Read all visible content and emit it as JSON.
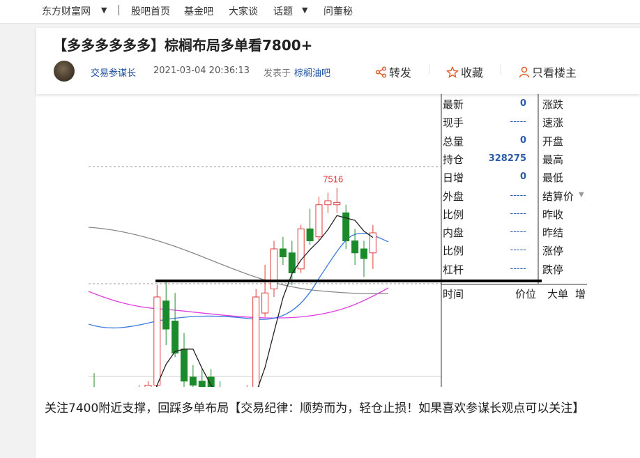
{
  "nav": {
    "site": "东方财富网",
    "items": [
      "股吧首页",
      "基金吧",
      "大家谈",
      "话题",
      "问董秘"
    ]
  },
  "post": {
    "title": "【多多多多多多】棕榈布局多单看7800+",
    "author": "交易参谋长",
    "datetime": "2021-03-04 20:36:13",
    "posted_in": "发表于",
    "bar_name": "棕榈油吧",
    "content": "关注7400附近支撑，回踩多单布局【交易纪律：顺势而为，轻仓止损！如果喜欢参谋长观点可以关注】"
  },
  "actions": {
    "share": "转发",
    "favorite": "收藏",
    "author_only": "只看楼主"
  },
  "colors": {
    "up": "#e03a3a",
    "down": "#1a8a2a",
    "link": "#1a4e9c",
    "value": "#2a5aa8"
  },
  "chart_data": {
    "type": "candlestick",
    "peak_label": "7516",
    "candles": [
      {
        "o": 7260,
        "h": 7285,
        "l": 7205,
        "c": 7215
      },
      {
        "o": 7235,
        "h": 7255,
        "l": 7215,
        "c": 7220
      },
      {
        "o": 7225,
        "h": 7240,
        "l": 7195,
        "c": 7215
      },
      {
        "o": 7220,
        "h": 7245,
        "l": 7200,
        "c": 7210
      },
      {
        "o": 7205,
        "h": 7235,
        "l": 7170,
        "c": 7230
      },
      {
        "o": 7235,
        "h": 7270,
        "l": 7225,
        "c": 7260
      },
      {
        "o": 7250,
        "h": 7275,
        "l": 7240,
        "c": 7270
      },
      {
        "o": 7270,
        "h": 7395,
        "l": 7260,
        "c": 7380
      },
      {
        "o": 7375,
        "h": 7400,
        "l": 7320,
        "c": 7340
      },
      {
        "o": 7350,
        "h": 7385,
        "l": 7305,
        "c": 7310
      },
      {
        "o": 7315,
        "h": 7335,
        "l": 7265,
        "c": 7275
      },
      {
        "o": 7280,
        "h": 7295,
        "l": 7255,
        "c": 7270
      },
      {
        "o": 7275,
        "h": 7290,
        "l": 7255,
        "c": 7260
      },
      {
        "o": 7280,
        "h": 7290,
        "l": 7225,
        "c": 7235
      },
      {
        "o": 7240,
        "h": 7275,
        "l": 7220,
        "c": 7225
      },
      {
        "o": 7255,
        "h": 7265,
        "l": 7205,
        "c": 7220
      },
      {
        "o": 7230,
        "h": 7245,
        "l": 7210,
        "c": 7215
      },
      {
        "o": 7250,
        "h": 7270,
        "l": 7240,
        "c": 7260
      },
      {
        "o": 7255,
        "h": 7390,
        "l": 7250,
        "c": 7380
      },
      {
        "o": 7360,
        "h": 7420,
        "l": 7355,
        "c": 7385
      },
      {
        "o": 7390,
        "h": 7450,
        "l": 7380,
        "c": 7440
      },
      {
        "o": 7440,
        "h": 7455,
        "l": 7420,
        "c": 7430
      },
      {
        "o": 7435,
        "h": 7450,
        "l": 7395,
        "c": 7410
      },
      {
        "o": 7415,
        "h": 7470,
        "l": 7410,
        "c": 7465
      },
      {
        "o": 7465,
        "h": 7490,
        "l": 7445,
        "c": 7450
      },
      {
        "o": 7455,
        "h": 7505,
        "l": 7450,
        "c": 7495
      },
      {
        "o": 7495,
        "h": 7510,
        "l": 7485,
        "c": 7500
      },
      {
        "o": 7495,
        "h": 7516,
        "l": 7485,
        "c": 7498
      },
      {
        "o": 7485,
        "h": 7495,
        "l": 7440,
        "c": 7450
      },
      {
        "o": 7450,
        "h": 7465,
        "l": 7420,
        "c": 7435
      },
      {
        "o": 7440,
        "h": 7450,
        "l": 7405,
        "c": 7428
      },
      {
        "o": 7435,
        "h": 7470,
        "l": 7415,
        "c": 7460
      }
    ],
    "support_level": 7400
  },
  "quote_panel": {
    "rows": [
      {
        "label": "最新",
        "value": "0",
        "label2": "涨跌"
      },
      {
        "label": "现手",
        "value": "-----",
        "label2": "速涨"
      },
      {
        "label": "总量",
        "value": "0",
        "label2": "开盘"
      },
      {
        "label": "持仓",
        "value": "328275",
        "label2": "最高"
      },
      {
        "label": "日增",
        "value": "0",
        "label2": "最低"
      },
      {
        "label": "外盘",
        "value": "-----",
        "label2": "结算价"
      },
      {
        "label": "比例",
        "value": "-----",
        "label2": "昨收"
      },
      {
        "label": "内盘",
        "value": "-----",
        "label2": "昨结"
      },
      {
        "label": "比例",
        "value": "-----",
        "label2": "涨停"
      },
      {
        "label": "杠杆",
        "value": "-----",
        "label2": "跌停"
      }
    ],
    "trade_headers": [
      "时间",
      "价位",
      "大单",
      "增"
    ]
  }
}
